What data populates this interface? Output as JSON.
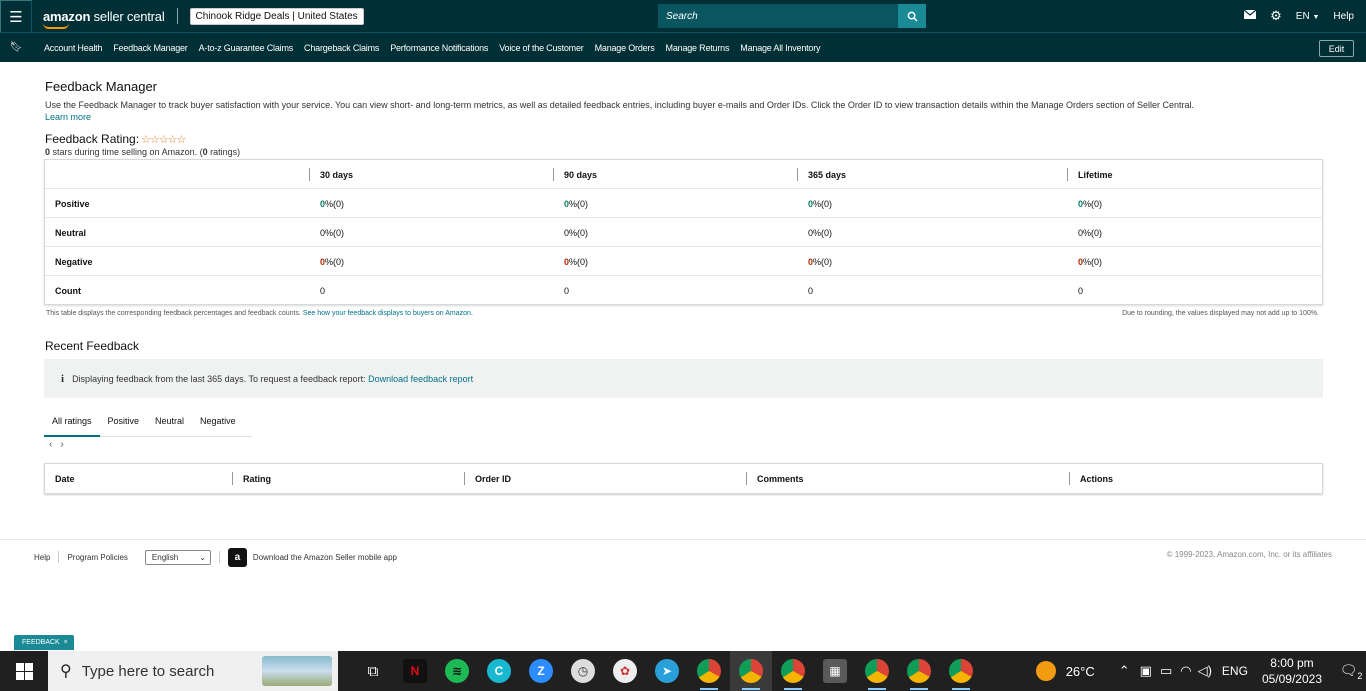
{
  "topbar": {
    "brand_main": "amazon",
    "brand_sub": "seller central",
    "store": "Chinook Ridge Deals | United States",
    "search_placeholder": "Search",
    "lang": "EN",
    "help": "Help"
  },
  "navbar": {
    "items": [
      "Account Health",
      "Feedback Manager",
      "A-to-z Guarantee Claims",
      "Chargeback Claims",
      "Performance Notifications",
      "Voice of the Customer",
      "Manage Orders",
      "Manage Returns",
      "Manage All Inventory"
    ],
    "edit": "Edit"
  },
  "page": {
    "title": "Feedback Manager",
    "intro": "Use the Feedback Manager to track buyer satisfaction with your service. You can view short- and long-term metrics, as well as detailed feedback entries, including buyer e-mails and Order IDs. Click the Order ID to view transaction details within the Manage Orders section of Seller Central.",
    "learn_more": "Learn more",
    "rating_title": "Feedback Rating:",
    "stars": "☆☆☆☆☆",
    "rating_stars_value": "0",
    "rating_sub_mid": " stars during time selling on Amazon. (",
    "rating_count": "0",
    "rating_sub_end": " ratings)"
  },
  "metrics": {
    "headers": [
      "30 days",
      "90 days",
      "365 days",
      "Lifetime"
    ],
    "rows": [
      {
        "label": "Positive",
        "values": [
          "0",
          "0",
          "0",
          "0"
        ],
        "counts": [
          "(0)",
          "(0)",
          "(0)",
          "(0)"
        ]
      },
      {
        "label": "Neutral",
        "values": [
          "0",
          "0",
          "0",
          "0"
        ],
        "counts": [
          "(0)",
          "(0)",
          "(0)",
          "(0)"
        ]
      },
      {
        "label": "Negative",
        "values": [
          "0",
          "0",
          "0",
          "0"
        ],
        "counts": [
          "(0)",
          "(0)",
          "(0)",
          "(0)"
        ]
      },
      {
        "label": "Count",
        "values": [
          "0",
          "0",
          "0",
          "0"
        ]
      }
    ],
    "percent_sign": " %",
    "note_left": "This table displays the corresponding feedback percentages and feedback counts.",
    "note_left_link": "See how your feedback displays to buyers on Amazon.",
    "note_right": "Due to rounding, the values displayed may not add up to 100%."
  },
  "recent": {
    "title": "Recent Feedback",
    "info_icon": "i",
    "info_text": "Displaying feedback from the last 365 days. To request a feedback report:",
    "info_link": "Download feedback report",
    "tabs": [
      "All ratings",
      "Positive",
      "Neutral",
      "Negative"
    ],
    "pager_prev": "‹",
    "pager_next": "›",
    "columns": [
      "Date",
      "Rating",
      "Order ID",
      "Comments",
      "Actions"
    ]
  },
  "footer": {
    "help": "Help",
    "policies": "Program Policies",
    "language": "English",
    "app_text": "Download the Amazon Seller mobile app",
    "copyright": "© 1999-2023, Amazon.com, Inc. or its affiliates",
    "feedback_tab": "FEEDBACK",
    "feedback_close": "×"
  },
  "taskbar": {
    "search_text": "Type here to search",
    "temperature": "26°C",
    "lang": "ENG",
    "time": "8:00 pm",
    "date": "05/09/2023",
    "notif_count": "2"
  }
}
